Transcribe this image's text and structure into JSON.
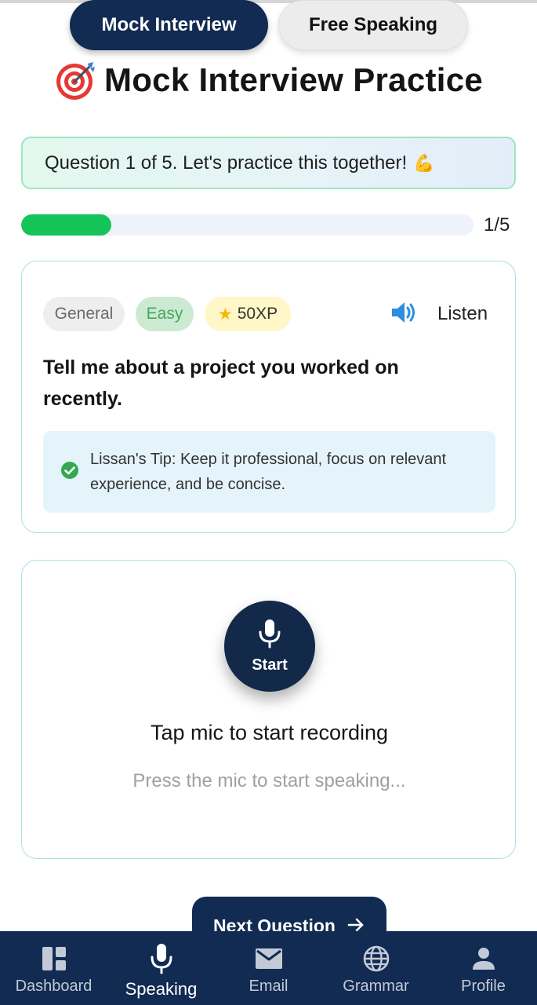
{
  "tabs": [
    {
      "label": "Mock Interview",
      "active": true
    },
    {
      "label": "Free Speaking",
      "active": false
    }
  ],
  "page": {
    "title": "Mock Interview Practice",
    "title_icon": "target-icon"
  },
  "banner": {
    "text": "Question 1 of 5. Let's practice this together!",
    "emoji": "💪"
  },
  "progress": {
    "current": 1,
    "total": 5,
    "label": "1/5",
    "fraction": 0.2
  },
  "question_card": {
    "category": "General",
    "difficulty": "Easy",
    "xp": "50XP",
    "listen_label": "Listen",
    "question": "Tell me about a project you worked on recently.",
    "tip": "Lissan's Tip: Keep it professional, focus on relevant experience, and be concise."
  },
  "recorder": {
    "button_label": "Start",
    "title": "Tap mic to start recording",
    "hint": "Press the mic to start speaking..."
  },
  "next_button": {
    "label": "Next Question"
  },
  "nav": {
    "items": [
      {
        "label": "Dashboard",
        "icon": "dashboard-icon",
        "active": false
      },
      {
        "label": "Speaking",
        "icon": "mic-icon",
        "active": true
      },
      {
        "label": "Email",
        "icon": "email-icon",
        "active": false
      },
      {
        "label": "Grammar",
        "icon": "globe-icon",
        "active": false
      },
      {
        "label": "Profile",
        "icon": "profile-icon",
        "active": false
      }
    ]
  },
  "colors": {
    "navy": "#112b52",
    "progress_green": "#14c458",
    "banner_border": "#9fe5bf",
    "card_border": "#a9dfe6",
    "tip_bg": "#e5f3fb",
    "speaker_blue": "#2a8fe0"
  }
}
